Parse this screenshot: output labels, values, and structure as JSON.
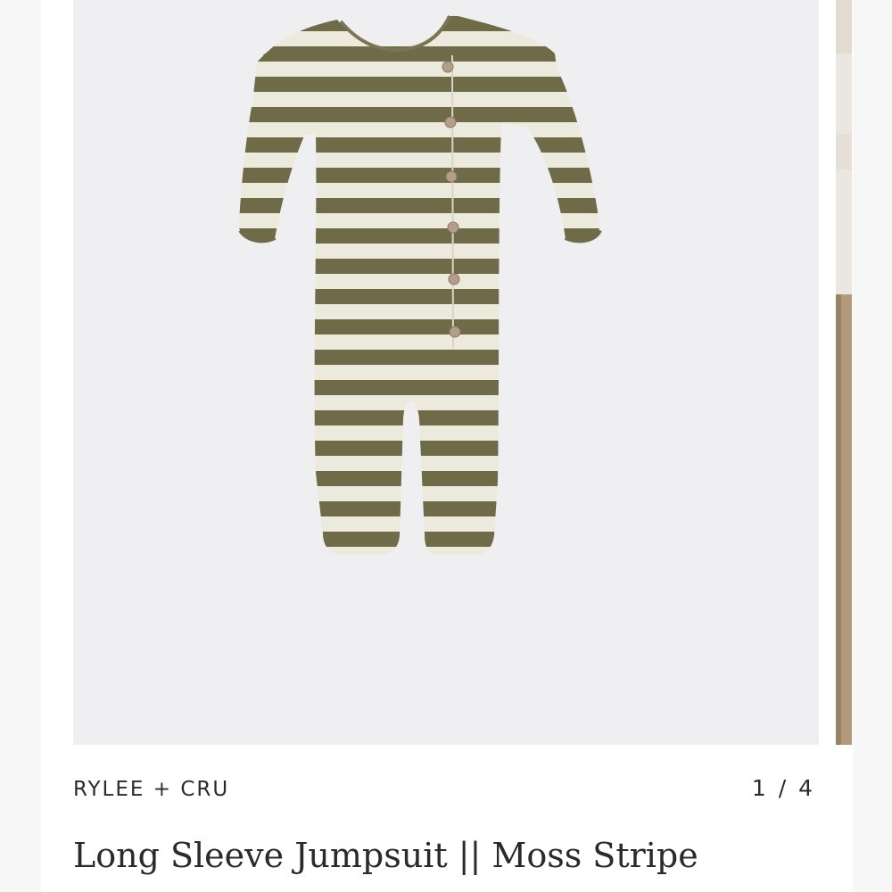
{
  "product": {
    "brand": "RYLEE + CRU",
    "title": "Long Sleeve Jumpsuit || Moss Stripe",
    "image_alt": "striped long sleeve baby jumpsuit"
  },
  "gallery": {
    "counter": "1 / 4",
    "current_index": 1,
    "total_images": 4
  },
  "colors": {
    "stripe_dark": "#6f6a48",
    "stripe_light": "#eceadd",
    "gallery_bg": "#efeff1",
    "button": "#b39e8c"
  }
}
